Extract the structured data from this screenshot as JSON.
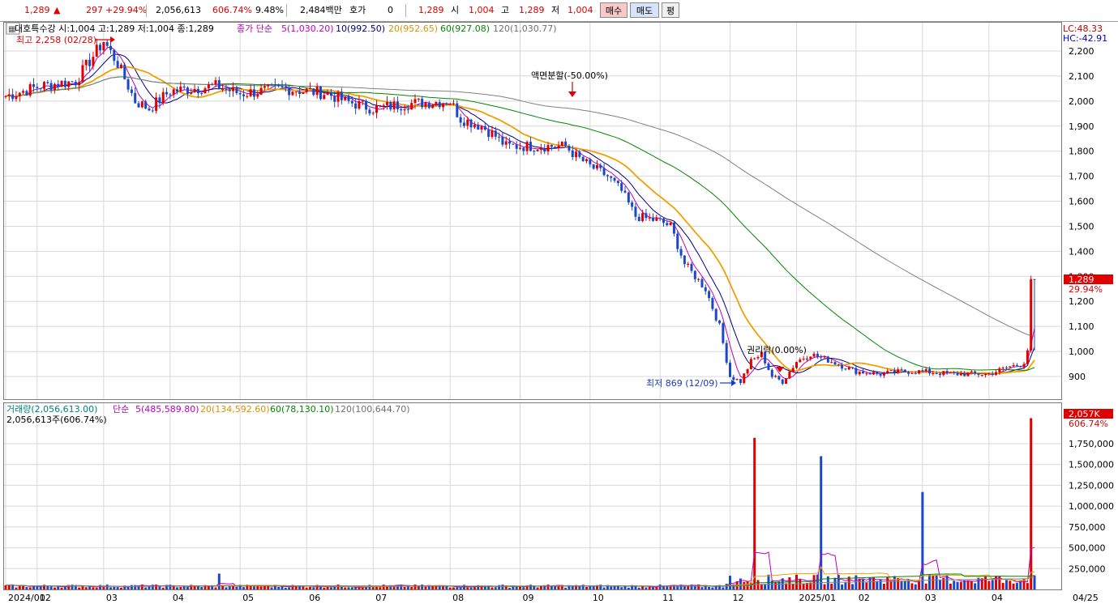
{
  "quote": {
    "price": "1,289",
    "arrow": "▲",
    "change": "297",
    "change_pct": "+29.94%",
    "volume": "2,056,613",
    "volume_ratio": "606.74%",
    "turnover": "9.48%",
    "amount": "2,484백만",
    "hoga_label": "호가",
    "hoga_value": "0",
    "hoga_price": "1,289",
    "open_label": "시",
    "open": "1,004",
    "high_label": "고",
    "high": "1,289",
    "low_label": "저",
    "low": "1,004",
    "buy_label": "매수",
    "sell_label": "매도",
    "avg_label": "평"
  },
  "colors": {
    "up": "#e00000",
    "down": "#1a48c8",
    "ma5": "#c000c0",
    "ma10": "#000080",
    "ma20": "#f0a000",
    "ma60": "#008800",
    "ma120": "#808080",
    "grid": "#d8d8d8"
  },
  "price_panel": {
    "legend_stock": "대호특수강 시:1,004 고:1,289 저:1,004 종:1,289",
    "legend_ma_head": "종가 단순",
    "legend_ma5": "5(1,030.20)",
    "legend_ma10": "10(992.50)",
    "legend_ma20": "20(952.65)",
    "legend_ma60": "60(927.08)",
    "legend_ma120": "120(1,030.77)",
    "lc": "LC:48.33",
    "hc": "HC:-42.91",
    "high_note": "최고 2,258 (02/28)",
    "low_note": "최저 869 (12/09)",
    "event_note": "액면분할(-50.00%)",
    "event2_note": "권리락(0.00%)",
    "last_price_tag": "1,289",
    "last_pct_tag": "29.94%"
  },
  "volume_panel": {
    "legend_head": "거래량(2,056,613.00)",
    "legend_ma_head": "단순",
    "legend_ma5": "5(485,589.80)",
    "legend_ma20": "20(134,592.60)",
    "legend_ma60": "60(78,130.10)",
    "legend_ma120": "120(100,644.70)",
    "sub": "2,056,613주(606.74%)",
    "last_tag": "2,057K",
    "last_pct_tag": "606.74%"
  },
  "chart_data": {
    "type": "candlestick",
    "price_axis": {
      "ticks": [
        900,
        1000,
        1100,
        1200,
        1300,
        1400,
        1500,
        1600,
        1700,
        1800,
        1900,
        2000,
        2100,
        2200
      ],
      "tick_labels": [
        "900",
        "1,000",
        "1,100",
        "1,200",
        "1,300",
        "1,400",
        "1,500",
        "1,600",
        "1,700",
        "1,800",
        "1,900",
        "2,000",
        "2,100",
        "2,200"
      ],
      "range": [
        800,
        2300
      ]
    },
    "volume_axis": {
      "ticks": [
        250000,
        500000,
        750000,
        1000000,
        1250000,
        1500000,
        1750000
      ],
      "tick_labels": [
        "250,000",
        "500,000",
        "750,000",
        "1,000,000",
        "1,250,000",
        "1,500,000",
        "1,750,000"
      ],
      "range": [
        0,
        2100000
      ]
    },
    "x_labels": [
      "2024/01",
      "02",
      "03",
      "04",
      "05",
      "06",
      "07",
      "08",
      "09",
      "10",
      "11",
      "12",
      "2025/01",
      "02",
      "03",
      "04",
      "04/25"
    ],
    "x_label_days": [
      0,
      9,
      28,
      47,
      67,
      86,
      105,
      127,
      147,
      167,
      187,
      207,
      226,
      243,
      262,
      281,
      294
    ],
    "series_price_anchors": [
      {
        "day": 0,
        "close": 2020
      },
      {
        "day": 10,
        "close": 2060
      },
      {
        "day": 20,
        "close": 2080
      },
      {
        "day": 25,
        "close": 2180
      },
      {
        "day": 28,
        "close": 2240
      },
      {
        "day": 32,
        "close": 2150
      },
      {
        "day": 37,
        "close": 2000
      },
      {
        "day": 41,
        "close": 1970
      },
      {
        "day": 47,
        "close": 2040
      },
      {
        "day": 60,
        "close": 2060
      },
      {
        "day": 67,
        "close": 2030
      },
      {
        "day": 80,
        "close": 2050
      },
      {
        "day": 92,
        "close": 2030
      },
      {
        "day": 97,
        "close": 2000
      },
      {
        "day": 105,
        "close": 1970
      },
      {
        "day": 115,
        "close": 1990
      },
      {
        "day": 127,
        "close": 2000
      },
      {
        "day": 130,
        "close": 1930
      },
      {
        "day": 136,
        "close": 1900
      },
      {
        "day": 140,
        "close": 1860
      },
      {
        "day": 143,
        "close": 1820
      },
      {
        "day": 160,
        "close": 1820
      },
      {
        "day": 163,
        "close": 1780
      },
      {
        "day": 167,
        "close": 1740
      },
      {
        "day": 172,
        "close": 1700
      },
      {
        "day": 176,
        "close": 1640
      },
      {
        "day": 180,
        "close": 1540
      },
      {
        "day": 187,
        "close": 1520
      },
      {
        "day": 190,
        "close": 1500
      },
      {
        "day": 194,
        "close": 1350
      },
      {
        "day": 197,
        "close": 1300
      },
      {
        "day": 200,
        "close": 1250
      },
      {
        "day": 204,
        "close": 1100
      },
      {
        "day": 207,
        "close": 900
      },
      {
        "day": 210,
        "close": 880
      },
      {
        "day": 213,
        "close": 960
      },
      {
        "day": 216,
        "close": 990
      },
      {
        "day": 219,
        "close": 900
      },
      {
        "day": 222,
        "close": 880
      },
      {
        "day": 226,
        "close": 960
      },
      {
        "day": 230,
        "close": 990
      },
      {
        "day": 236,
        "close": 960
      },
      {
        "day": 243,
        "close": 920
      },
      {
        "day": 250,
        "close": 910
      },
      {
        "day": 256,
        "close": 920
      },
      {
        "day": 262,
        "close": 920
      },
      {
        "day": 270,
        "close": 910
      },
      {
        "day": 281,
        "close": 910
      },
      {
        "day": 287,
        "close": 940
      },
      {
        "day": 291,
        "close": 950
      },
      {
        "day": 292,
        "close": 1004
      },
      {
        "day": 293,
        "close": 1289
      }
    ],
    "volume_spikes": [
      {
        "day": 61,
        "volume": 190000
      },
      {
        "day": 214,
        "volume": 1820000
      },
      {
        "day": 233,
        "volume": 1600000
      },
      {
        "day": 262,
        "volume": 1170000
      },
      {
        "day": 293,
        "volume": 2056613
      }
    ],
    "ma_lines": [
      "5",
      "10",
      "20",
      "60",
      "120"
    ]
  }
}
